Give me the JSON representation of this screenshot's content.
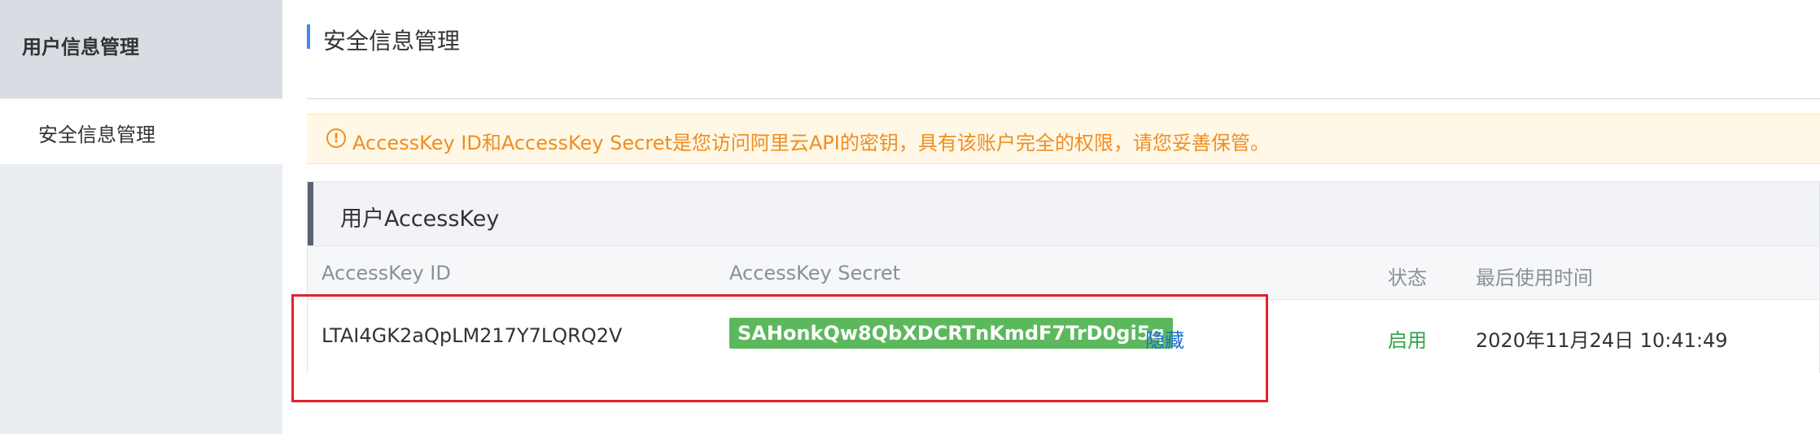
{
  "sidebar": {
    "title": "用户信息管理",
    "items": [
      {
        "label": "安全信息管理"
      }
    ]
  },
  "main": {
    "page_title": "安全信息管理",
    "alert": {
      "icon": "warning-circle-icon",
      "text": "AccessKey ID和AccessKey Secret是您访问阿里云API的密钥，具有该账户完全的权限，请您妥善保管。"
    },
    "panel": {
      "title": "用户AccessKey",
      "columns": [
        "AccessKey ID",
        "AccessKey Secret",
        "状态",
        "最后使用时间"
      ],
      "rows": [
        {
          "access_key_id": "LTAI4GK2aQpLM217Y7LQRQ2V",
          "access_key_secret": "SAHonkQw8QbXDCRTnKmdF7TrD0gi5q",
          "hide_label": "隐藏",
          "status": "启用",
          "last_used": "2020年11月24日 10:41:49"
        }
      ]
    }
  },
  "colors": {
    "accent_blue": "#3a8ee6",
    "alert_orange": "#f08d23",
    "secret_green": "#5cb85c",
    "status_green": "#2fa34a",
    "link_blue": "#1f6fd1",
    "highlight_red": "#e0232f"
  }
}
